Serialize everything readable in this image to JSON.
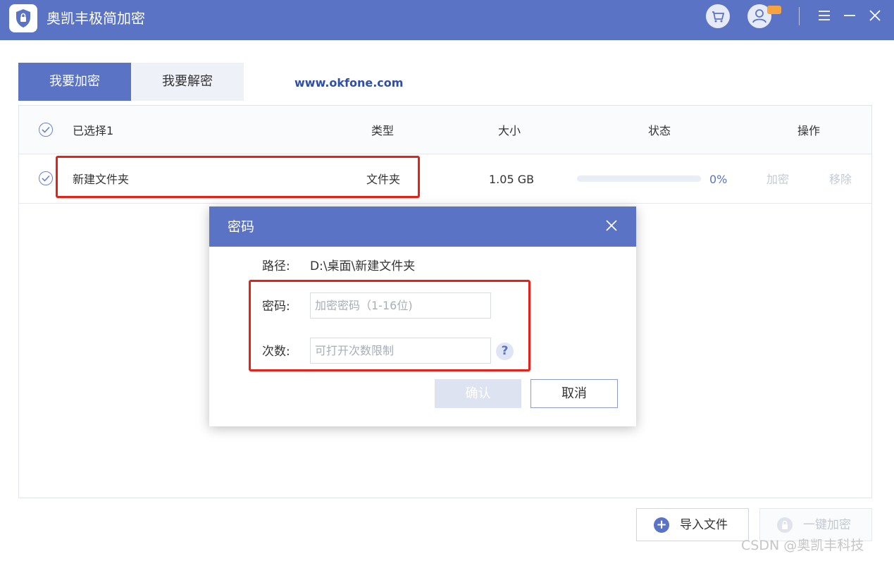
{
  "app": {
    "title": "奥凯丰极简加密",
    "colors": {
      "primary": "#5a73c5",
      "highlight": "#e8201a"
    },
    "icons": [
      "shield-lock-icon",
      "cart-icon",
      "user-icon",
      "menu-icon",
      "minimize-icon",
      "close-icon"
    ]
  },
  "tabs": [
    {
      "label": "我要加密",
      "active": true
    },
    {
      "label": "我要解密",
      "active": false
    }
  ],
  "website": "www.okfone.com",
  "table": {
    "selected_label": "已选择1",
    "headers": {
      "type": "类型",
      "size": "大小",
      "status": "状态",
      "action": "操作"
    },
    "rows": [
      {
        "name": "新建文件夹",
        "type": "文件夹",
        "size": "1.05 GB",
        "progress_percent": 0,
        "progress_text": "0%",
        "action_encrypt": "加密",
        "action_remove": "移除"
      }
    ]
  },
  "dialog": {
    "title": "密码",
    "path_label": "路径:",
    "path_value": "D:\\桌面\\新建文件夹",
    "password_label": "密码:",
    "password_placeholder": "加密密码（1-16位)",
    "count_label": "次数:",
    "count_placeholder": "可打开次数限制",
    "help_symbol": "?",
    "confirm_label": "确认",
    "cancel_label": "取消"
  },
  "footer": {
    "import_label": "导入文件",
    "onekey_label": "一键加密"
  },
  "watermark": "CSDN @奥凯丰科技"
}
